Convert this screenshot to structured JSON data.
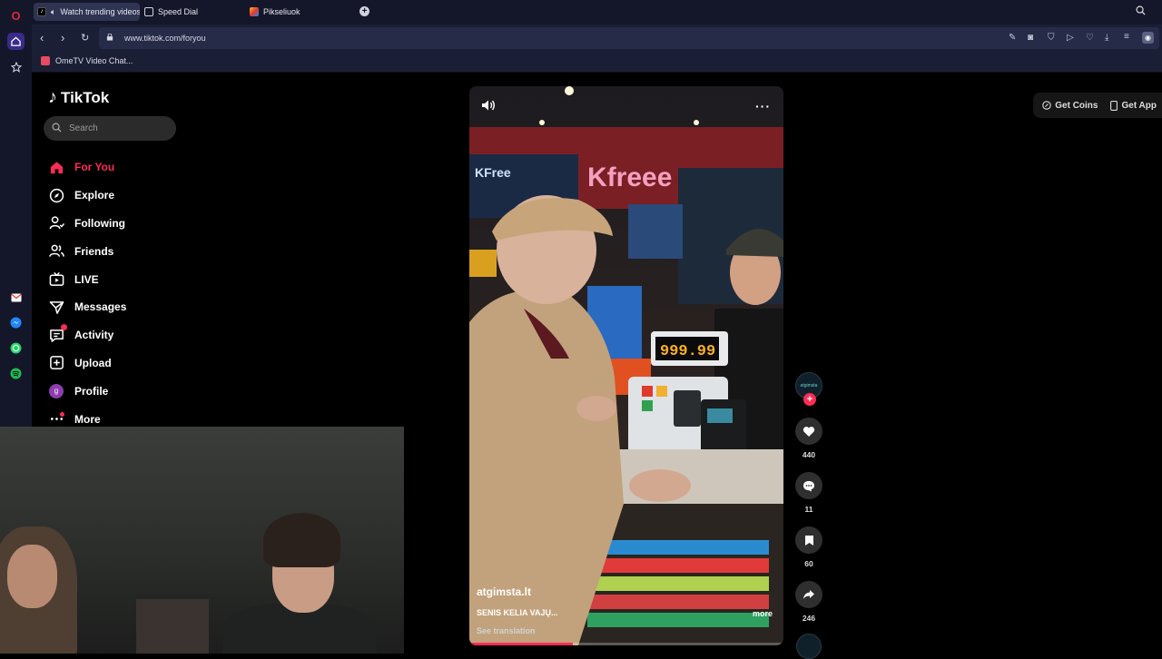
{
  "browser": {
    "tabs": [
      {
        "label": "Watch trending videos",
        "active": true
      },
      {
        "label": "Speed Dial",
        "active": false
      },
      {
        "label": "Pikseliuok",
        "active": false
      }
    ],
    "new_tab_icon": "+",
    "url": "www.tiktok.com/foryou",
    "bookmarks": [
      {
        "label": "OmeTV Video Chat..."
      }
    ]
  },
  "tiktok": {
    "logo_text": "TikTok",
    "search_placeholder": "Search",
    "nav": [
      {
        "label": "For You",
        "icon": "home-icon",
        "active": true
      },
      {
        "label": "Explore",
        "icon": "compass-icon"
      },
      {
        "label": "Following",
        "icon": "following-icon"
      },
      {
        "label": "Friends",
        "icon": "friends-icon"
      },
      {
        "label": "LIVE",
        "icon": "live-icon"
      },
      {
        "label": "Messages",
        "icon": "messages-icon"
      },
      {
        "label": "Activity",
        "icon": "activity-icon"
      },
      {
        "label": "Upload",
        "icon": "upload-icon"
      },
      {
        "label": "Profile",
        "icon": "avatar",
        "avatar_letter": "g"
      },
      {
        "label": "More",
        "icon": "more-icon"
      }
    ],
    "top_right": {
      "get_coins": "Get Coins",
      "get_app": "Get App"
    },
    "video": {
      "author": "atgimsta.lt",
      "caption": "SENIS KELIA VAJŲ...",
      "see_translation": "See translation",
      "more": "more",
      "progress": 0.33,
      "register_display": "999.99",
      "store_sign": "Kfreee",
      "store_sign_small": "KFree"
    },
    "actions": {
      "avatar_text": "atgimsta",
      "likes": "440",
      "comments": "11",
      "saves": "60",
      "shares": "246"
    }
  },
  "colors": {
    "accent": "#fe2c55",
    "opera_rail": "#14172a"
  }
}
